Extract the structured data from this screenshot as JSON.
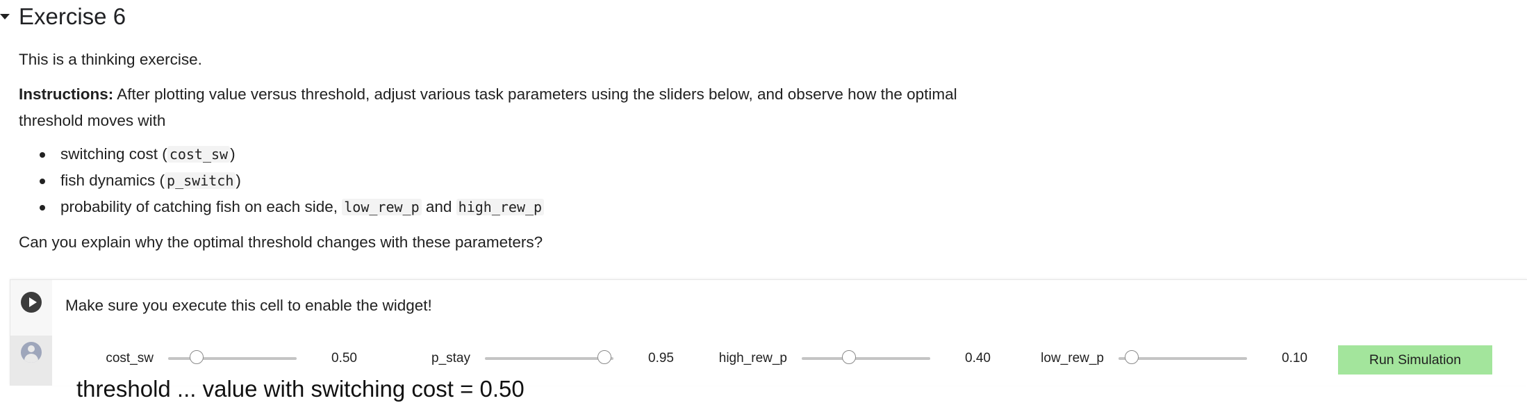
{
  "section": {
    "title": "Exercise 6"
  },
  "intro": {
    "line1": "This is a thinking exercise.",
    "instructions_bold": "Instructions:",
    "instructions_text": " After plotting value versus threshold, adjust various task parameters using the sliders below, and observe how the optimal",
    "instructions_cont": "threshold moves with"
  },
  "bullets": [
    {
      "text": "switching cost (",
      "code": "cost_sw",
      "tail": ")"
    },
    {
      "text": "fish dynamics (",
      "code": "p_switch",
      "tail": ")"
    },
    {
      "text": "probability of catching fish on each side, ",
      "code": "low_rew_p",
      "mid": " and ",
      "code2": "high_rew_p"
    }
  ],
  "question": "Can you explain why the optimal threshold changes with these parameters?",
  "cell": {
    "message": "Make sure you execute this cell to enable the widget!",
    "widgets": {
      "cost_sw": {
        "label": "cost_sw",
        "value": "0.50",
        "fraction": 0.22
      },
      "p_stay": {
        "label": "p_stay",
        "value": "0.95",
        "fraction": 0.93
      },
      "high_rew_p": {
        "label": "high_rew_p",
        "value": "0.40",
        "fraction": 0.37
      },
      "low_rew_p": {
        "label": "low_rew_p",
        "value": "0.10",
        "fraction": 0.1
      }
    },
    "run_button": "Run Simulation",
    "truncated_output": "threshold  ...  value with switching cost = 0.50"
  }
}
